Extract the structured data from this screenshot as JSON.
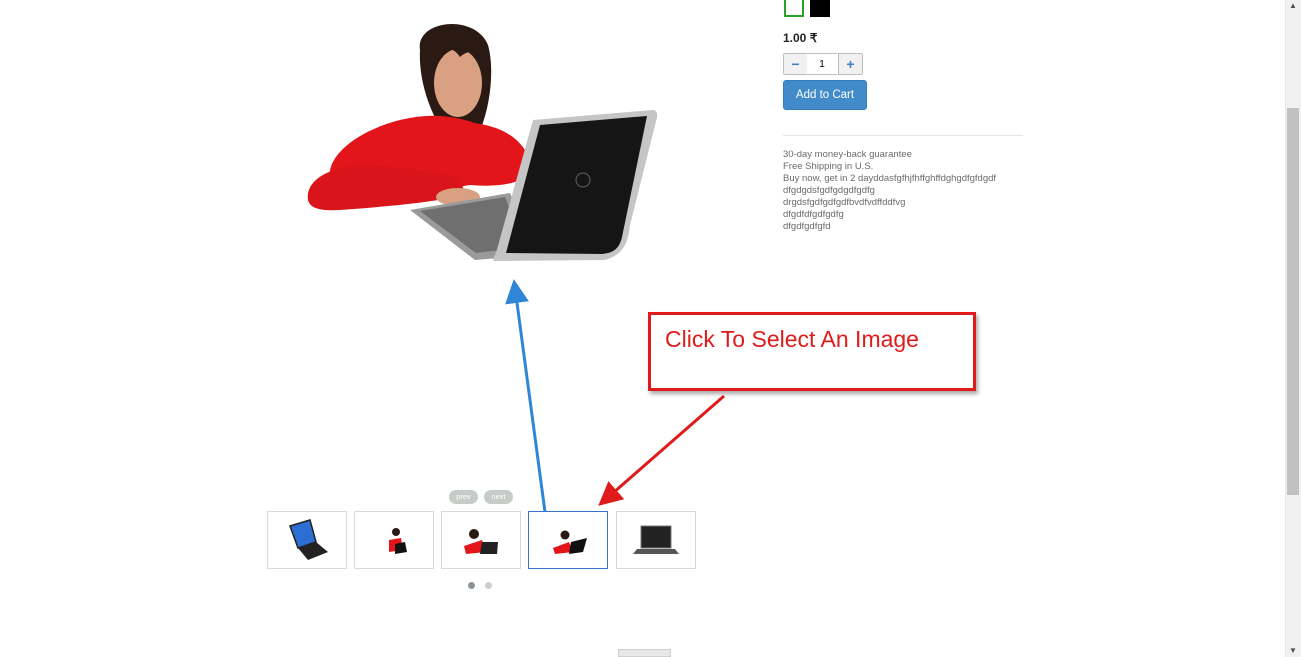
{
  "product": {
    "price": "1.00 ₹",
    "quantity": "1",
    "add_to_cart_label": "Add to Cart",
    "qty_minus_label": "−",
    "qty_plus_label": "+",
    "swatches": [
      {
        "name": "white",
        "color": "#ffffff",
        "selected": true
      },
      {
        "name": "black",
        "color": "#000000",
        "selected": false
      }
    ],
    "info_lines": [
      "30-day money-back guarantee",
      "Free Shipping in U.S.",
      "Buy now, get in 2 dayddasfgfhjfhffghffdghgdfgfdgdf",
      "dfgdgdsfgdfgdgdfgdfg",
      "drgdsfgdfgdfgdfbvdfvdffddfvg",
      "dfgdfdfgdfgdfg",
      "dfgdfgdfgfd"
    ]
  },
  "gallery": {
    "main_image": "woman-with-laptop",
    "prev_label": "prev",
    "next_label": "next",
    "thumbnails": [
      {
        "image": "laptop-tilted",
        "selected": false
      },
      {
        "image": "woman-with-laptop-small",
        "selected": false
      },
      {
        "image": "woman-with-laptop",
        "selected": false
      },
      {
        "image": "woman-with-laptop",
        "selected": true
      },
      {
        "image": "laptop-front",
        "selected": false
      }
    ],
    "pages": 2,
    "active_page": 1
  },
  "annotation": {
    "text": "Click To Select An Image",
    "color": "#e01b1b",
    "pointer_color": "#2f86d6"
  }
}
